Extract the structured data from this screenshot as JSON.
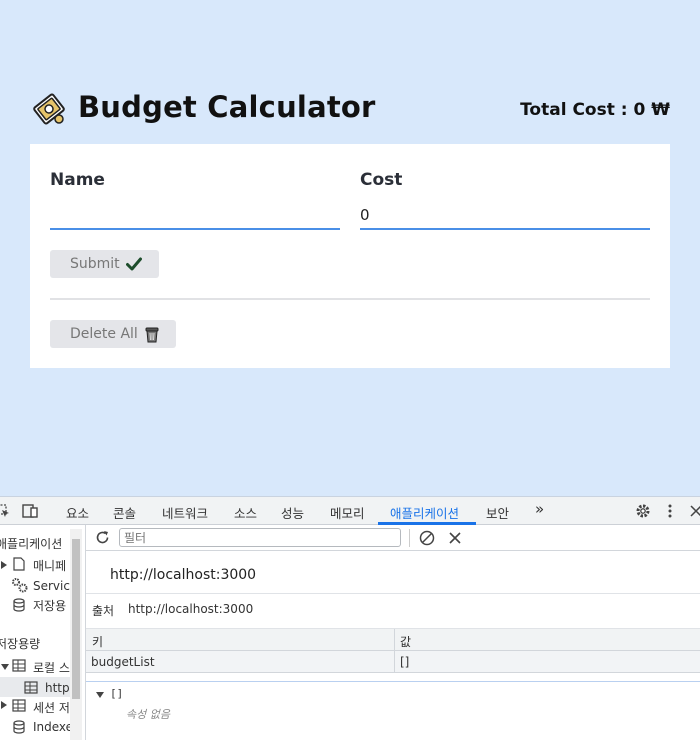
{
  "app": {
    "title": "Budget Calculator",
    "total_cost": "Total Cost : 0 ₩",
    "form": {
      "name_label": "Name",
      "name_value": "",
      "cost_label": "Cost",
      "cost_value": "0"
    },
    "submit_label": "Submit",
    "delete_all_label": "Delete All"
  },
  "devtools": {
    "tabs": [
      "요소",
      "콘솔",
      "네트워크",
      "소스",
      "성능",
      "메모리",
      "애플리케이션",
      "보안",
      "»"
    ],
    "active_tab": "애플리케이션",
    "sidebar": {
      "app_header": "애플리케이션",
      "manifest": "매니페",
      "service_worker": "Service",
      "storage": "저장용",
      "storage_section": "저장용량",
      "local_storage": "로컬 스",
      "local_storage_origin": "http",
      "session_storage": "세션 저",
      "indexed_db": "Indexe"
    },
    "filter_placeholder": "필터",
    "origin_title": "http://localhost:3000",
    "origin_label": "출처",
    "origin_value": "http://localhost:3000",
    "table": {
      "key_header": "키",
      "value_header": "값",
      "rows": [
        {
          "key": "budgetList",
          "value": "[]"
        }
      ]
    },
    "preview": {
      "tree_label": "[]",
      "empty_text": "속성 없음"
    }
  },
  "colors": {
    "page_bg": "#d8e8fb",
    "input_underline": "#4a8fe7",
    "devtools_accent": "#1a73e8"
  }
}
